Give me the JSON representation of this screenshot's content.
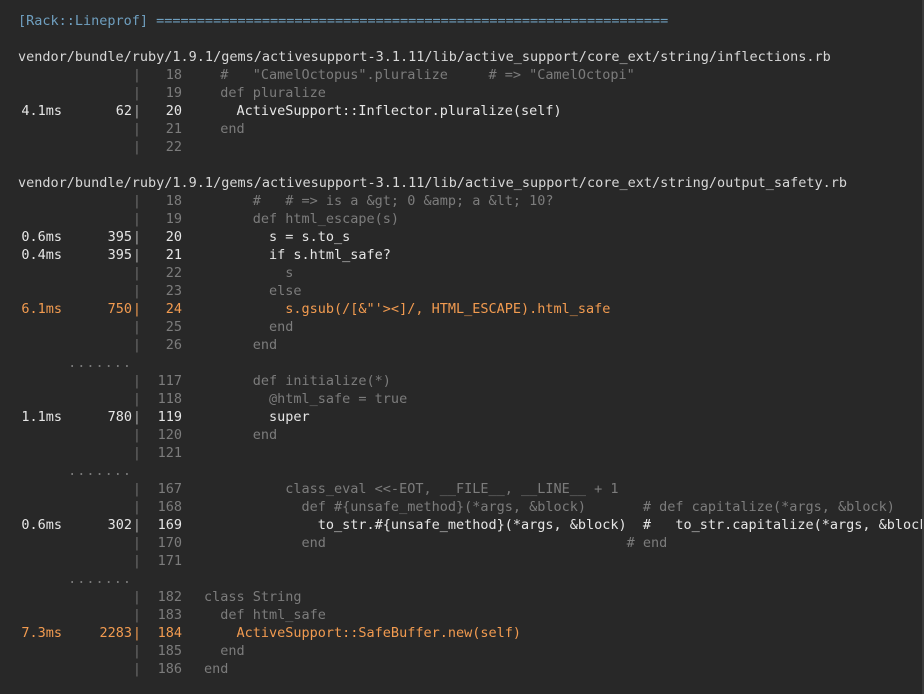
{
  "header": "[Rack::Lineprof] ===============================================================",
  "files": [
    {
      "path": "vendor/bundle/ruby/1.9.1/gems/activesupport-3.1.11/lib/active_support/core_ext/string/inflections.rb",
      "blocks": [
        {
          "lines": [
            {
              "time": "",
              "calls": "",
              "no": "18",
              "code": "  #   \"CamelOctopus\".pluralize     # => \"CamelOctopi\"",
              "level": "muted"
            },
            {
              "time": "",
              "calls": "",
              "no": "19",
              "code": "  def pluralize",
              "level": "muted"
            },
            {
              "time": "4.1ms",
              "calls": "62",
              "no": "20",
              "code": "    ActiveSupport::Inflector.pluralize(self)",
              "level": "normal"
            },
            {
              "time": "",
              "calls": "",
              "no": "21",
              "code": "  end",
              "level": "muted"
            },
            {
              "time": "",
              "calls": "",
              "no": "22",
              "code": "",
              "level": "muted"
            }
          ]
        }
      ]
    },
    {
      "path": "vendor/bundle/ruby/1.9.1/gems/activesupport-3.1.11/lib/active_support/core_ext/string/output_safety.rb",
      "blocks": [
        {
          "lines": [
            {
              "time": "",
              "calls": "",
              "no": "18",
              "code": "      #   # => is a &gt; 0 &amp; a &lt; 10?",
              "level": "muted"
            },
            {
              "time": "",
              "calls": "",
              "no": "19",
              "code": "      def html_escape(s)",
              "level": "muted"
            },
            {
              "time": "0.6ms",
              "calls": "395",
              "no": "20",
              "code": "        s = s.to_s",
              "level": "normal"
            },
            {
              "time": "0.4ms",
              "calls": "395",
              "no": "21",
              "code": "        if s.html_safe?",
              "level": "normal"
            },
            {
              "time": "",
              "calls": "",
              "no": "22",
              "code": "          s",
              "level": "muted"
            },
            {
              "time": "",
              "calls": "",
              "no": "23",
              "code": "        else",
              "level": "muted"
            },
            {
              "time": "6.1ms",
              "calls": "750",
              "no": "24",
              "code": "          s.gsub(/[&\"'><]/, HTML_ESCAPE).html_safe",
              "level": "hot"
            },
            {
              "time": "",
              "calls": "",
              "no": "25",
              "code": "        end",
              "level": "muted"
            },
            {
              "time": "",
              "calls": "",
              "no": "26",
              "code": "      end",
              "level": "muted"
            }
          ]
        },
        {
          "separator": ".......",
          "lines": [
            {
              "time": "",
              "calls": "",
              "no": "117",
              "code": "      def initialize(*)",
              "level": "muted"
            },
            {
              "time": "",
              "calls": "",
              "no": "118",
              "code": "        @html_safe = true",
              "level": "muted"
            },
            {
              "time": "1.1ms",
              "calls": "780",
              "no": "119",
              "code": "        super",
              "level": "normal"
            },
            {
              "time": "",
              "calls": "",
              "no": "120",
              "code": "      end",
              "level": "muted"
            },
            {
              "time": "",
              "calls": "",
              "no": "121",
              "code": "",
              "level": "muted"
            }
          ]
        },
        {
          "separator": ".......",
          "lines": [
            {
              "time": "",
              "calls": "",
              "no": "167",
              "code": "          class_eval <<-EOT, __FILE__, __LINE__ + 1",
              "level": "muted"
            },
            {
              "time": "",
              "calls": "",
              "no": "168",
              "code": "            def #{unsafe_method}(*args, &block)       # def capitalize(*args, &block)",
              "level": "muted"
            },
            {
              "time": "0.6ms",
              "calls": "302",
              "no": "169",
              "code": "              to_str.#{unsafe_method}(*args, &block)  #   to_str.capitalize(*args, &block)",
              "level": "normal"
            },
            {
              "time": "",
              "calls": "",
              "no": "170",
              "code": "            end                                     # end",
              "level": "muted"
            },
            {
              "time": "",
              "calls": "",
              "no": "171",
              "code": "",
              "level": "muted"
            }
          ]
        },
        {
          "separator": ".......",
          "lines": [
            {
              "time": "",
              "calls": "",
              "no": "182",
              "code": "class String",
              "level": "muted"
            },
            {
              "time": "",
              "calls": "",
              "no": "183",
              "code": "  def html_safe",
              "level": "muted"
            },
            {
              "time": "7.3ms",
              "calls": "2283",
              "no": "184",
              "code": "    ActiveSupport::SafeBuffer.new(self)",
              "level": "hot"
            },
            {
              "time": "",
              "calls": "",
              "no": "185",
              "code": "  end",
              "level": "muted"
            },
            {
              "time": "",
              "calls": "",
              "no": "186",
              "code": "end",
              "level": "muted"
            }
          ]
        }
      ]
    }
  ],
  "colors": {
    "background": "#282828",
    "header": "#6f9fbf",
    "hot": "#f29b50",
    "muted": "#7c7c7c",
    "normal": "#e6e6e6"
  }
}
